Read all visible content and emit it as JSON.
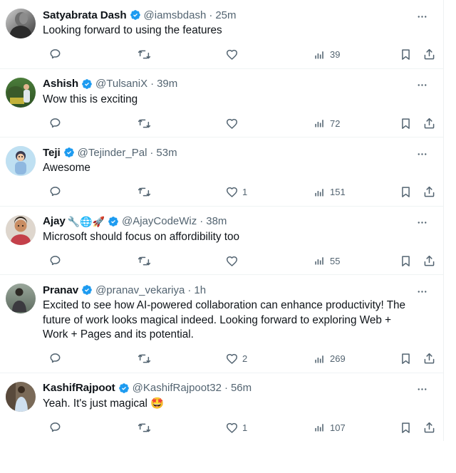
{
  "app": {
    "name": "X",
    "view": "tweet-replies-timeline"
  },
  "icons": {
    "reply": "reply-icon",
    "retweet": "retweet-icon",
    "like": "like-icon",
    "views": "views-icon",
    "bookmark": "bookmark-icon",
    "share": "share-icon",
    "more": "more-options-icon",
    "verified": "verified-badge-icon"
  },
  "colors": {
    "accent": "#1d9bf0",
    "text": "#0f1419",
    "muted": "#536471",
    "divider": "#eff3f4",
    "background": "#ffffff"
  },
  "tweets": [
    {
      "display_name": "Satyabrata Dash",
      "name_emoji": "",
      "verified": true,
      "handle": "@iamsbdash",
      "separator": "·",
      "timestamp": "25m",
      "text": "Looking forward to using the features",
      "reply_count": "",
      "retweet_count": "",
      "like_count": "",
      "view_count": "39",
      "avatar_name": "avatar-satyabrata-dash"
    },
    {
      "display_name": "Ashish",
      "name_emoji": "",
      "verified": true,
      "handle": "@TulsaniX",
      "separator": "·",
      "timestamp": "39m",
      "text": "Wow this is exciting",
      "reply_count": "",
      "retweet_count": "",
      "like_count": "",
      "view_count": "72",
      "avatar_name": "avatar-ashish"
    },
    {
      "display_name": "Teji",
      "name_emoji": "",
      "verified": true,
      "handle": "@Tejinder_Pal",
      "separator": "·",
      "timestamp": "53m",
      "text": "Awesome",
      "reply_count": "",
      "retweet_count": "",
      "like_count": "1",
      "view_count": "151",
      "avatar_name": "avatar-teji"
    },
    {
      "display_name": "Ajay",
      "name_emoji": "🔧🌐🚀",
      "verified": true,
      "handle": "@AjayCodeWiz",
      "separator": "·",
      "timestamp": "38m",
      "text": "Microsoft should focus on affordibility too",
      "reply_count": "",
      "retweet_count": "",
      "like_count": "",
      "view_count": "55",
      "avatar_name": "avatar-ajay"
    },
    {
      "display_name": "Pranav",
      "name_emoji": "",
      "verified": true,
      "handle": "@pranav_vekariya",
      "separator": "·",
      "timestamp": "1h",
      "text": "Excited to see how AI-powered collaboration can enhance productivity! The future of work looks magical indeed. Looking forward to exploring Web + Work + Pages and its potential.",
      "reply_count": "",
      "retweet_count": "",
      "like_count": "2",
      "view_count": "269",
      "avatar_name": "avatar-pranav"
    },
    {
      "display_name": "KashifRajpoot",
      "name_emoji": "",
      "verified": true,
      "handle": "@KashifRajpoot32",
      "separator": "·",
      "timestamp": "56m",
      "text": "Yeah. It's just magical 🤩",
      "reply_count": "",
      "retweet_count": "",
      "like_count": "1",
      "view_count": "107",
      "avatar_name": "avatar-kashifrajpoot"
    }
  ]
}
